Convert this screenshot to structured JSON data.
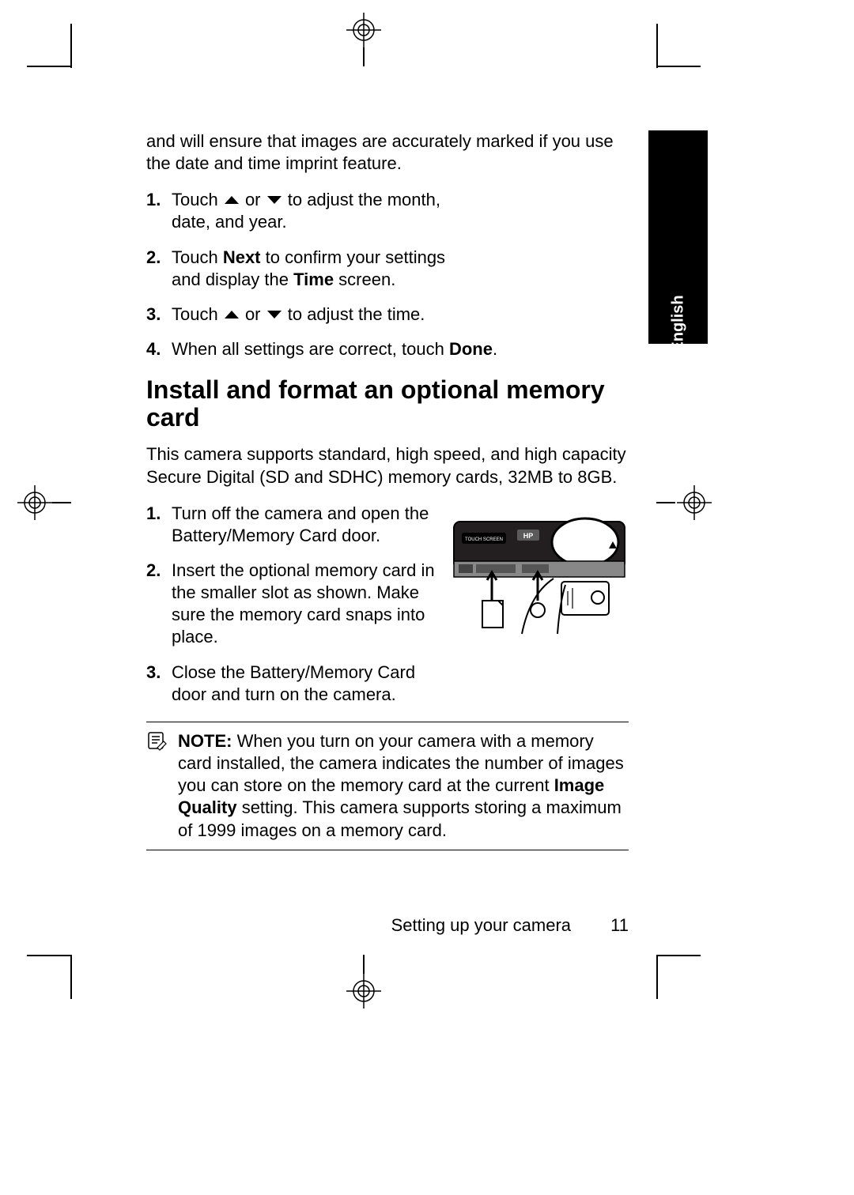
{
  "language_tab": "English",
  "intro_top": "and will ensure that images are accurately marked if you use the date and time imprint feature.",
  "steps_a": {
    "1": {
      "pre": "Touch ",
      "mid": " or ",
      "post": " to adjust the month, date, and year."
    },
    "2": {
      "pre": "Touch ",
      "b1": "Next",
      "mid": " to confirm your settings and display the ",
      "b2": "Time",
      "post": " screen."
    },
    "3": {
      "pre": "Touch ",
      "mid": " or ",
      "post": " to adjust the time."
    },
    "4": {
      "pre": "When all settings are correct, touch ",
      "b1": "Done",
      "post": "."
    }
  },
  "heading": "Install and format an optional memory card",
  "intro_b": "This camera supports standard, high speed, and high capacity Secure Digital (SD and SDHC) memory cards, 32MB to 8GB.",
  "steps_b": {
    "1": "Turn off the camera and open the Battery/Memory Card door.",
    "2": "Insert the optional memory card in the smaller slot as shown. Make sure the memory card snaps into place.",
    "3": "Close the Battery/Memory Card door and turn on the camera."
  },
  "note": {
    "label": "NOTE:",
    "pre": "  When you turn on your camera with a memory card installed, the camera indicates the number of images you can store on the memory card at the current ",
    "b1": "Image Quality",
    "post": " setting. This camera supports storing a maximum of 1999 images on a memory card."
  },
  "footer": {
    "section": "Setting up your camera",
    "page": "11"
  }
}
